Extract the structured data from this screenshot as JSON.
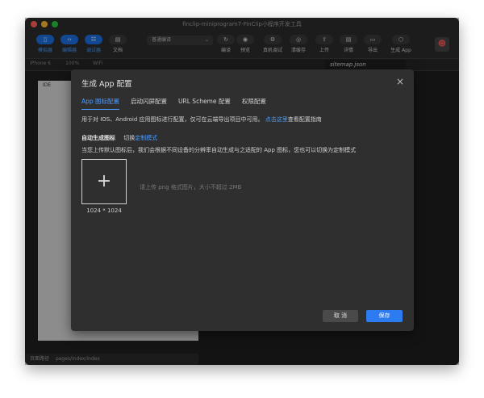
{
  "window": {
    "title": "finclip-miniprogram7-FinClip小程序开发工具",
    "colors": {
      "close": "#ff5f57",
      "minimize": "#febc2e",
      "maximize": "#28c840",
      "accent": "#2d7bf0"
    }
  },
  "toolbar": {
    "simulator_label": "模拟器",
    "editor_label": "编辑器",
    "debugger_label": "调试器",
    "docs_label": "文档",
    "compile_mode": "普通编译",
    "compile_label": "编译",
    "preview_label": "预览",
    "device_debug_label": "真机调试",
    "clear_cache_label": "清缓存",
    "upload_label": "上传",
    "details_label": "详情",
    "export_label": "导出",
    "generate_app_label": "生成 App"
  },
  "subbar": {
    "device": "iPhone 6",
    "zoom": "100%",
    "network": "WiFi"
  },
  "simulator": {
    "status": "IDE"
  },
  "editor": {
    "tab": "sitemap.json"
  },
  "bottombar": {
    "path_label": "页面路径",
    "path": "pages/index/index"
  },
  "dialog": {
    "title": "生成 App 配置",
    "close": "×",
    "tabs": [
      {
        "label": "App 图标配置"
      },
      {
        "label": "启动闪屏配置"
      },
      {
        "label": "URL Scheme 配置"
      },
      {
        "label": "权限配置"
      }
    ],
    "description": "用于对 IOS、Android 应用图标进行配置，仅可在云端导出项目中可用。",
    "description_link": "点击这里",
    "description_suffix": "查看配置指南",
    "auto_generate": "自动生成图标",
    "switch_prefix": "切换",
    "switch_custom": "定制模式",
    "help": "当您上传默认图标后，我们会根据不同设备的分辨率自动生成与之适配的 App 图标，您也可以切换为定制模式",
    "upload_plus": "+",
    "icon_size": "1024 * 1024",
    "upload_hint": "请上传 png 格式图片，大小不超过 2MB",
    "cancel_label": "取 消",
    "save_label": "保存"
  }
}
